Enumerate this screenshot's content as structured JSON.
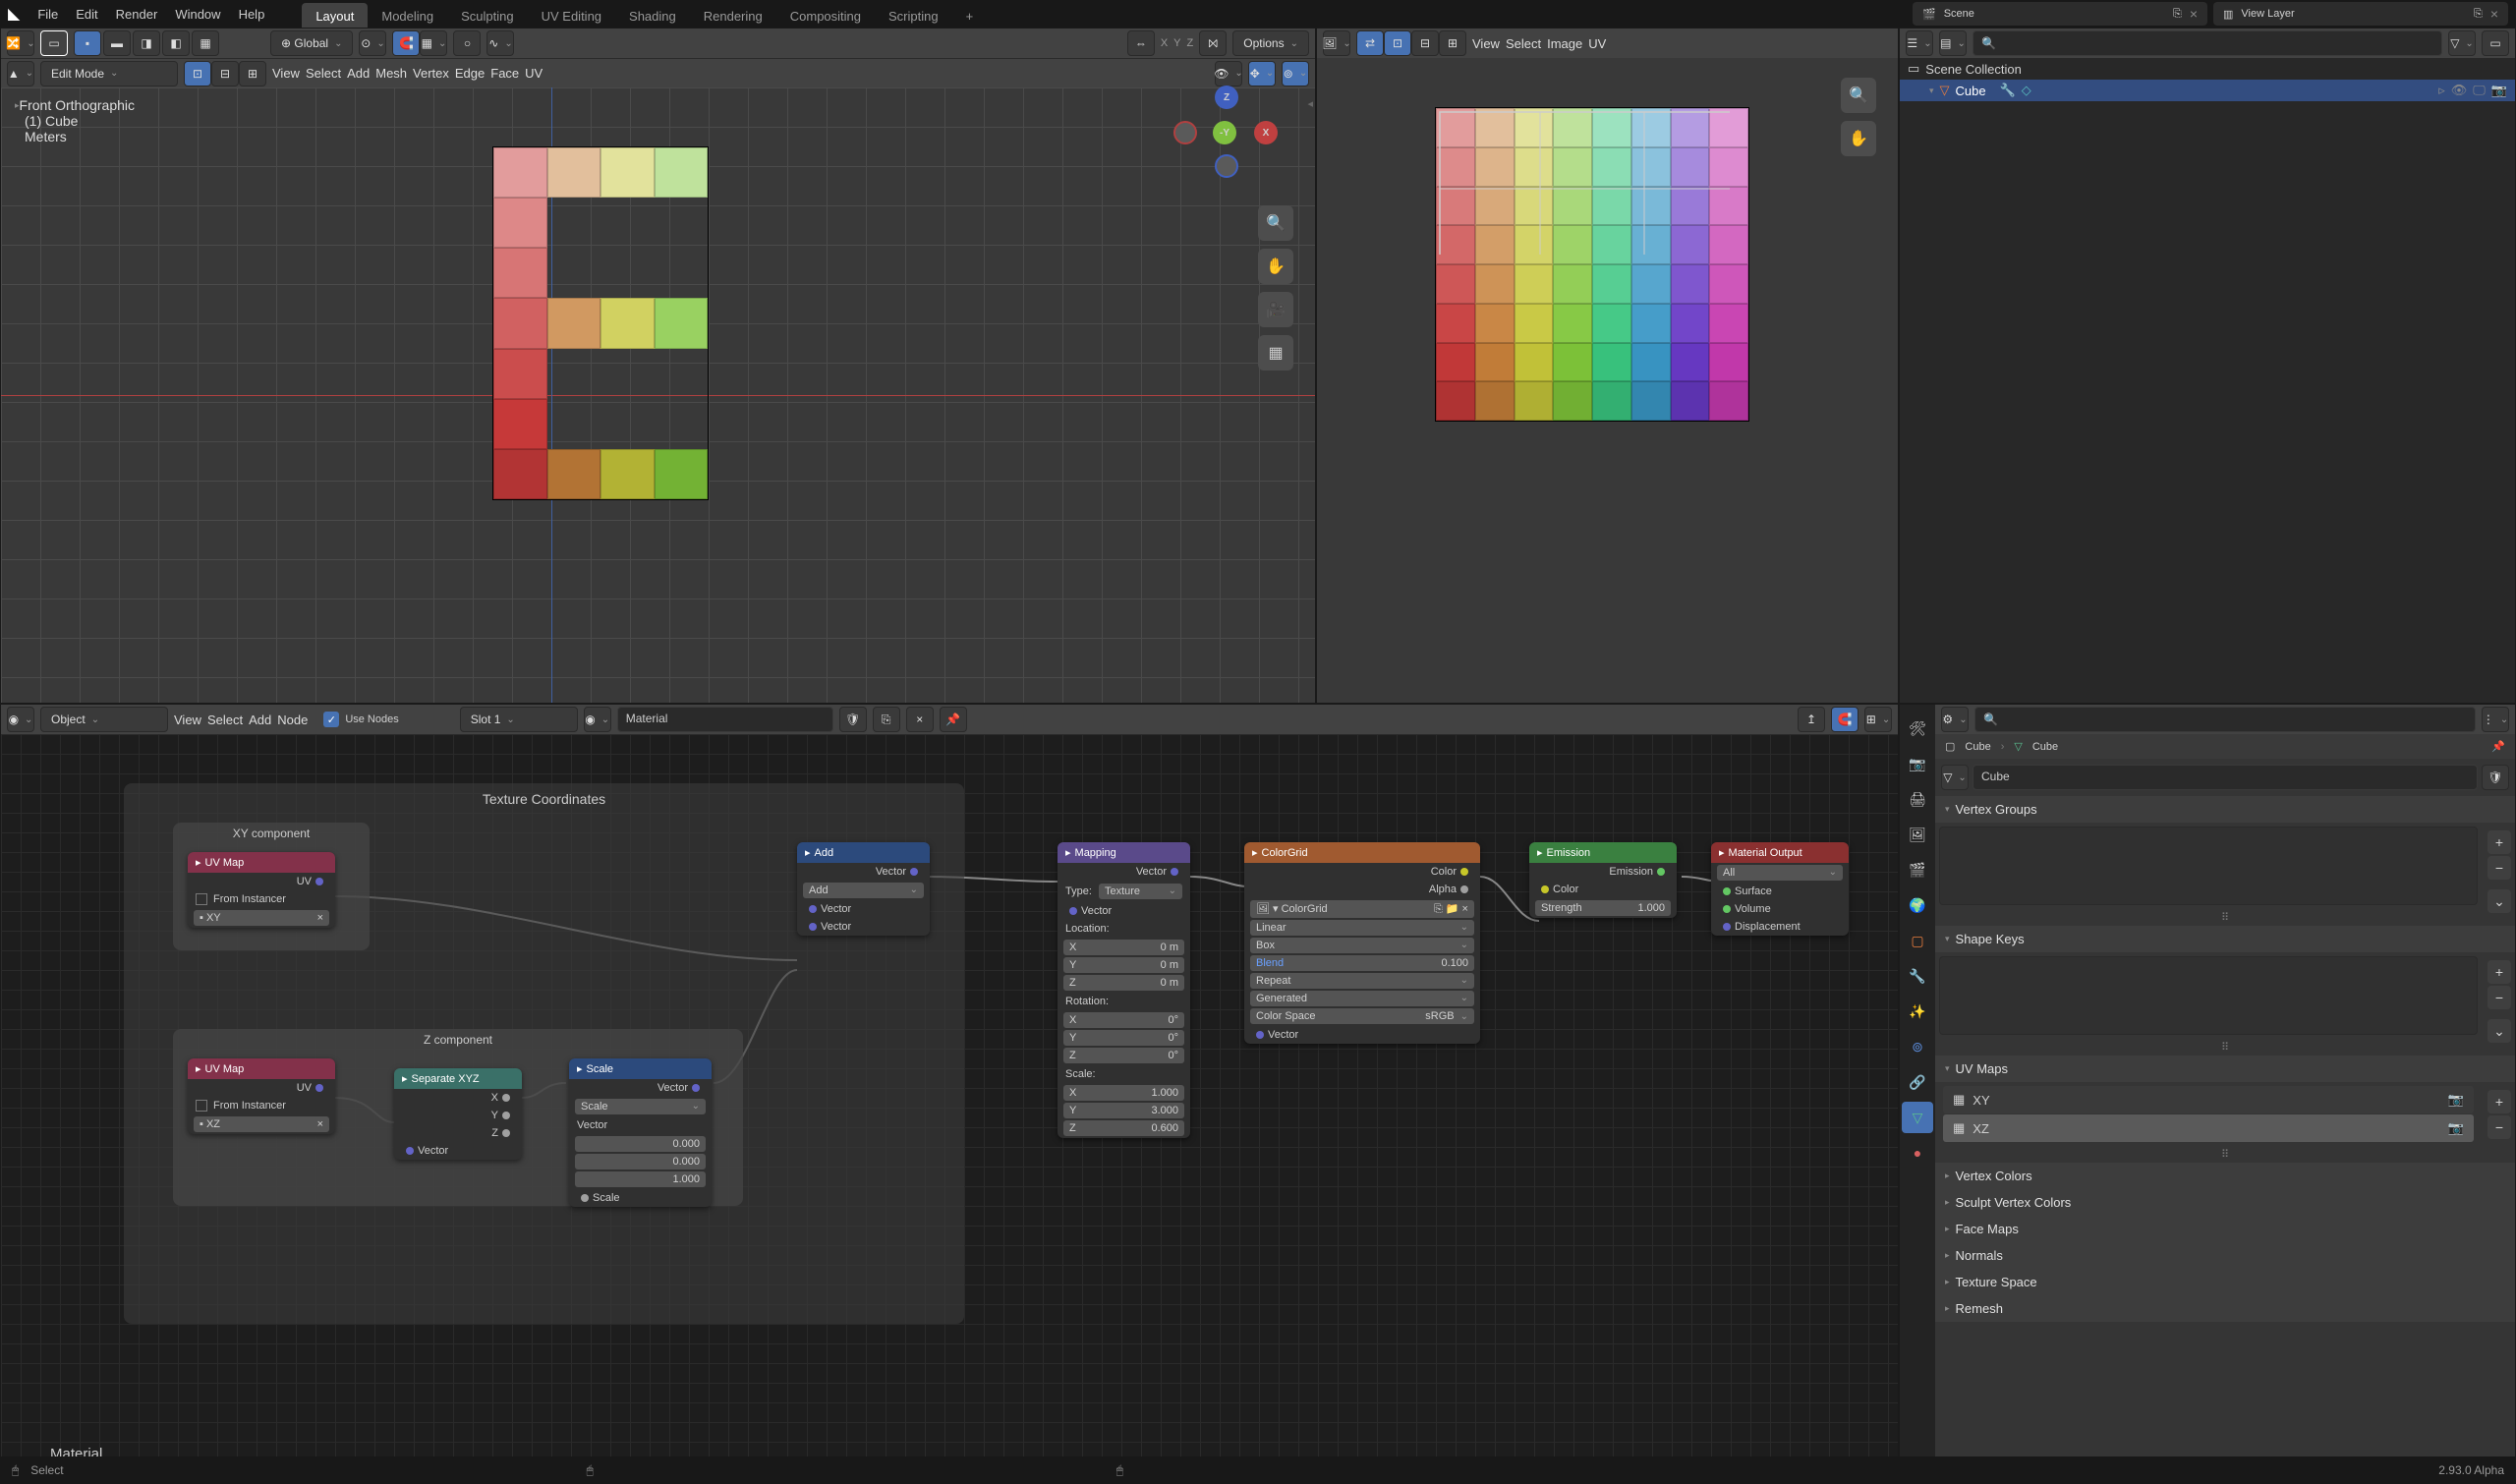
{
  "topbar": {
    "menus": [
      "File",
      "Edit",
      "Render",
      "Window",
      "Help"
    ],
    "workspaces": [
      "Layout",
      "Modeling",
      "Sculpting",
      "UV Editing",
      "Shading",
      "Rendering",
      "Compositing",
      "Scripting"
    ],
    "active_workspace": "Layout",
    "scene_label": "Scene",
    "viewlayer_label": "View Layer"
  },
  "viewport3d": {
    "hdr1_mode": "Edit Mode",
    "hdr1_menus": [
      "View",
      "Select",
      "Add",
      "Mesh",
      "Vertex",
      "Edge",
      "Face",
      "UV"
    ],
    "orientation": "Global",
    "options": "Options",
    "overlay": {
      "title": "Front Orthographic",
      "sub": "(1) Cube",
      "units": "Meters"
    },
    "gizmo": {
      "z": "Z",
      "y": "-Y",
      "x": "X"
    }
  },
  "uvimage": {
    "menus": [
      "View",
      "Select",
      "Image",
      "UV"
    ]
  },
  "shader": {
    "mode": "Object",
    "menus": [
      "View",
      "Select",
      "Add",
      "Node"
    ],
    "use_nodes_label": "Use Nodes",
    "use_nodes": true,
    "slot": "Slot 1",
    "material_name": "Material",
    "material_label": "Material",
    "frames": {
      "tc": "Texture Coordinates",
      "xy": "XY component",
      "z": "Z component"
    },
    "nodes": {
      "uvmap1": {
        "title": "UV Map",
        "uv": "UV",
        "from_instancer": "From Instancer",
        "map": "XY"
      },
      "uvmap2": {
        "title": "UV Map",
        "uv": "UV",
        "from_instancer": "From Instancer",
        "map": "XZ"
      },
      "sepxyz": {
        "title": "Separate XYZ",
        "x": "X",
        "y": "Y",
        "z": "Z",
        "vector": "Vector"
      },
      "scale": {
        "title": "Scale",
        "scale": "Scale",
        "vector": "Vector",
        "v1": "0.000",
        "v2": "0.000",
        "v3": "1.000"
      },
      "add": {
        "title": "Add",
        "vector": "Vector",
        "mode": "Add"
      },
      "mapping": {
        "title": "Mapping",
        "vector": "Vector",
        "type_l": "Type:",
        "type": "Texture",
        "location": "Location:",
        "lx": "X",
        "ly": "Y",
        "lz": "Z",
        "lv": "0 m",
        "rotation": "Rotation:",
        "rx": "X",
        "ry": "Y",
        "rz": "Z",
        "rv": "0°",
        "scale": "Scale:",
        "sx": "X",
        "sy": "Y",
        "sz": "Z",
        "svx": "1.000",
        "svy": "3.000",
        "svz": "0.600"
      },
      "colorgrid": {
        "title": "ColorGrid",
        "color": "Color",
        "alpha": "Alpha",
        "name": "ColorGrid",
        "interp": "Linear",
        "proj": "Box",
        "blend_l": "Blend",
        "blend_v": "0.100",
        "ext": "Repeat",
        "src": "Generated",
        "cs_l": "Color Space",
        "cs_v": "sRGB",
        "vector": "Vector"
      },
      "emission": {
        "title": "Emission",
        "emission": "Emission",
        "color": "Color",
        "strength_l": "Strength",
        "strength_v": "1.000"
      },
      "output": {
        "title": "Material Output",
        "target": "All",
        "surface": "Surface",
        "volume": "Volume",
        "disp": "Displacement"
      }
    }
  },
  "outliner": {
    "scene_collection": "Scene Collection",
    "cube": "Cube"
  },
  "properties": {
    "object_name": "Cube",
    "mesh_name": "Cube",
    "mesh_field": "Cube",
    "panels": {
      "vertex_groups": "Vertex Groups",
      "shape_keys": "Shape Keys",
      "uv_maps": "UV Maps",
      "vertex_colors": "Vertex Colors",
      "sculpt_vc": "Sculpt Vertex Colors",
      "face_maps": "Face Maps",
      "normals": "Normals",
      "tex_space": "Texture Space",
      "remesh": "Remesh"
    },
    "uv_maps": [
      "XY",
      "XZ"
    ]
  },
  "status": {
    "select": "Select",
    "version": "2.93.0 Alpha"
  }
}
